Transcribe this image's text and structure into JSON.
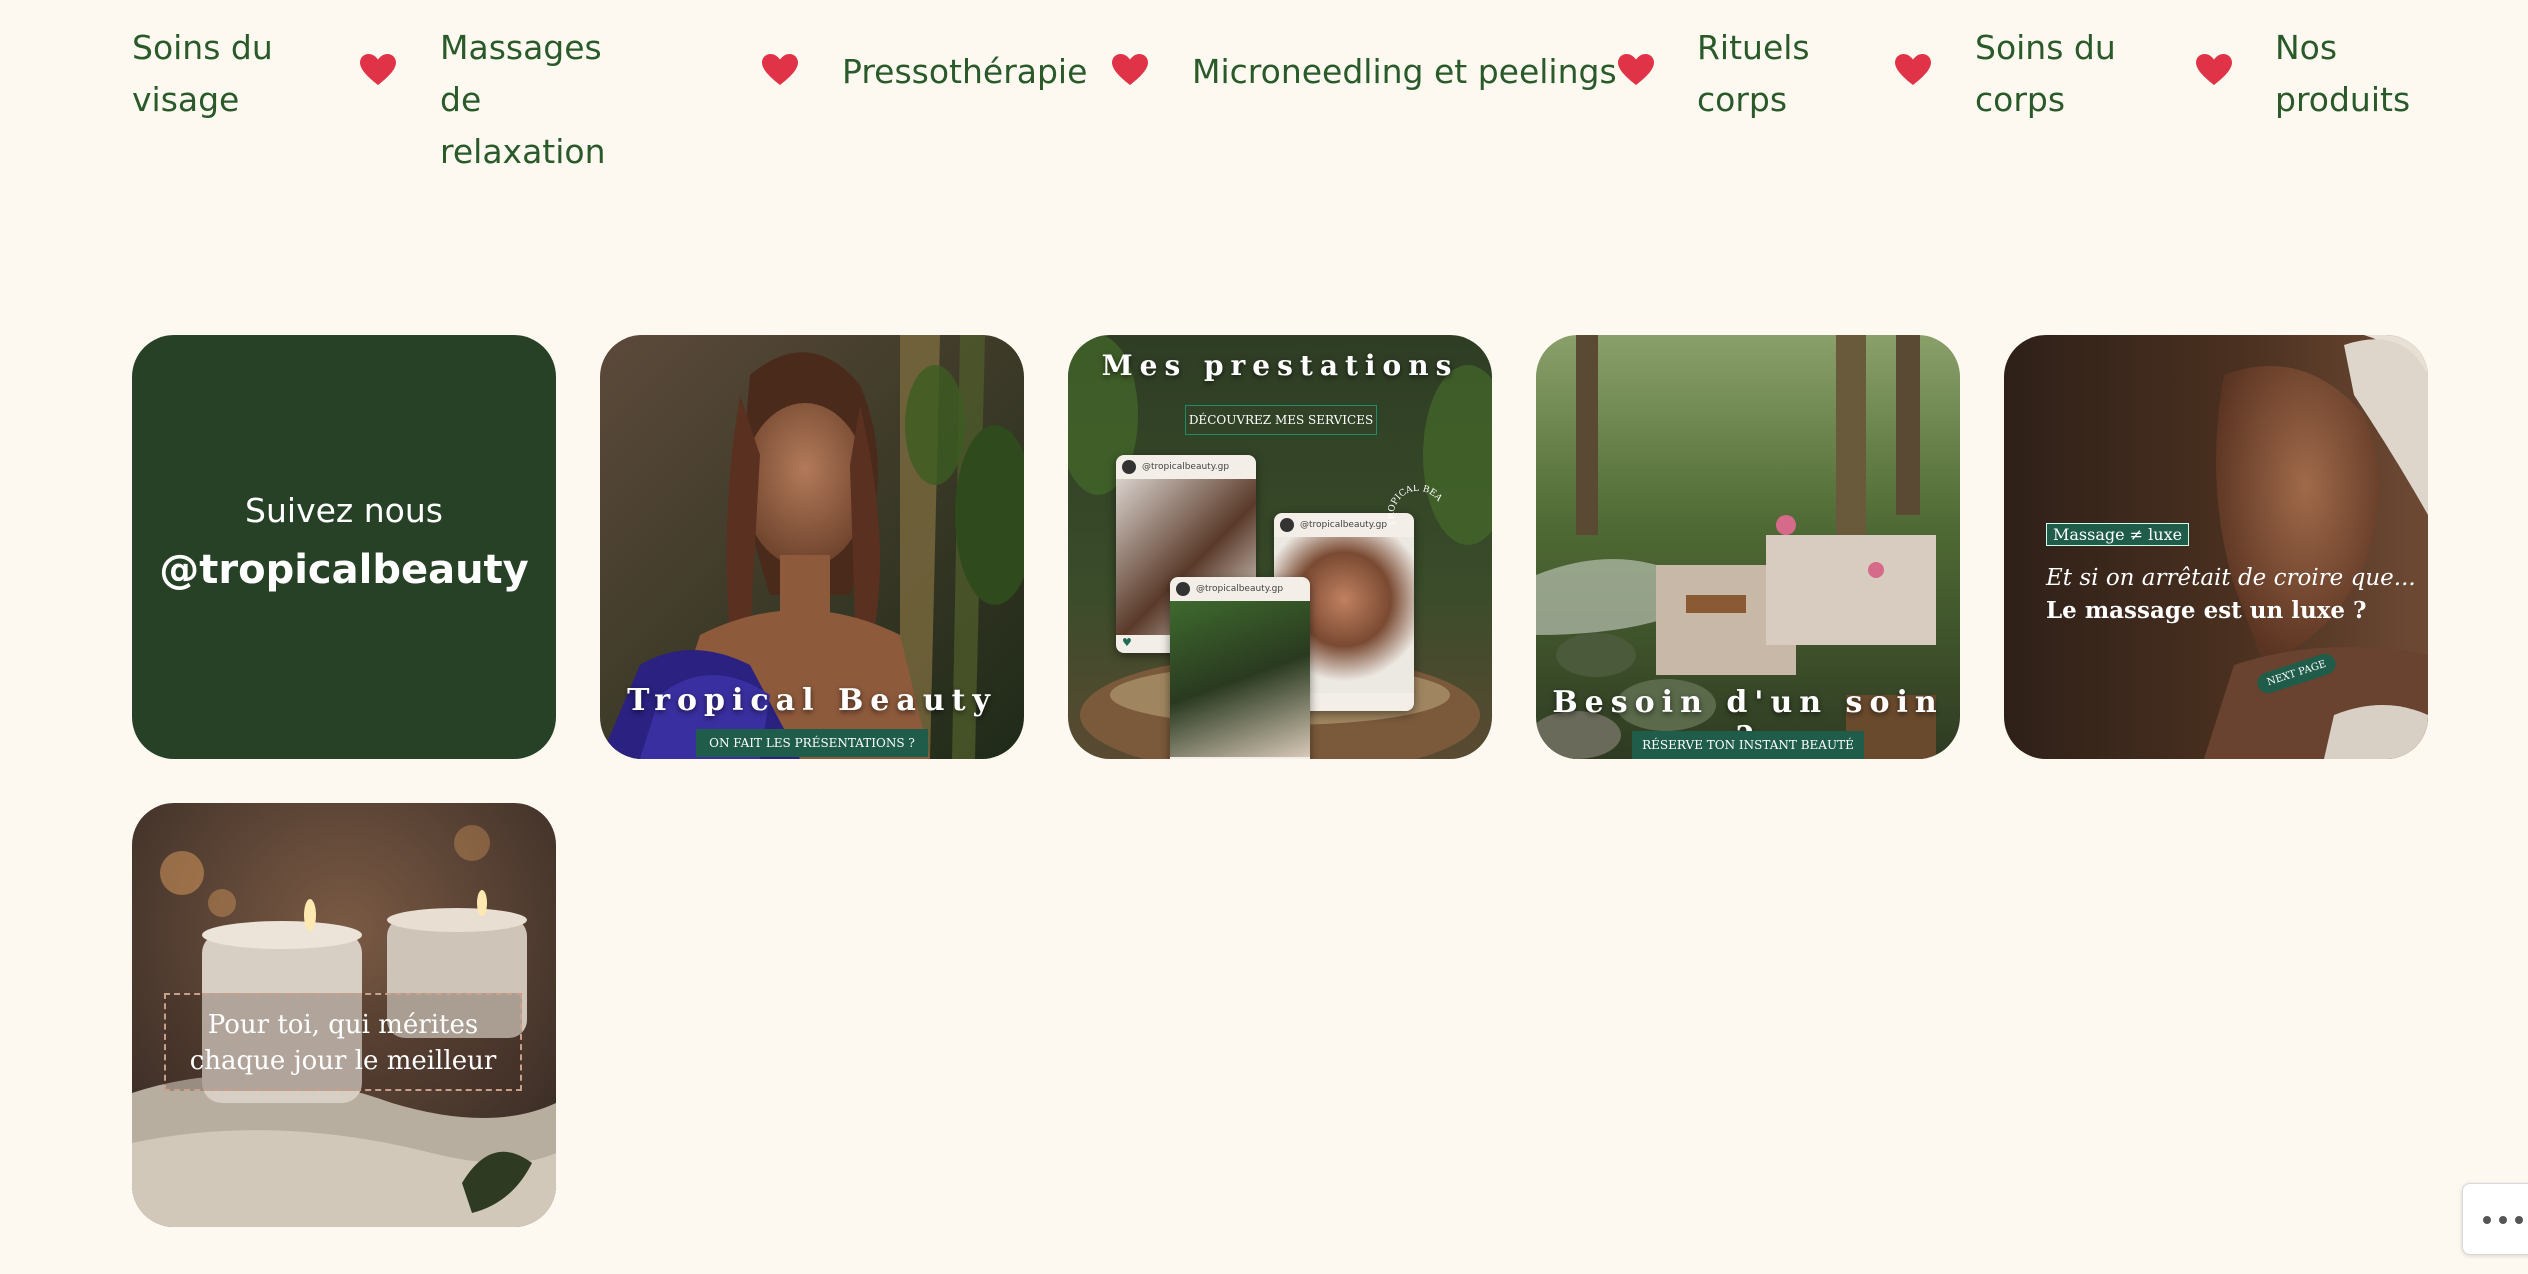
{
  "nav": {
    "items": [
      {
        "label": "Soins du visage"
      },
      {
        "label": "Massages de relaxation"
      },
      {
        "label": "Pressothérapie"
      },
      {
        "label": "Microneedling et peelings"
      },
      {
        "label": "Rituels corps"
      },
      {
        "label": "Soins du corps"
      },
      {
        "label": "Nos produits"
      }
    ],
    "separator_icon": "heart-icon",
    "separator_color": "#e03347",
    "text_color": "#2b5a2a"
  },
  "instagram": {
    "follow_line1": "Suivez nous",
    "follow_handle": "@tropicalbeauty",
    "posts": [
      {
        "title": "Tropical Beauty",
        "button": "ON FAIT LES PRÉSENTATIONS ?"
      },
      {
        "title": "Mes prestations",
        "button": "DÉCOUVREZ MES SERVICES",
        "post_handle": "@tropicalbeauty.gp",
        "badge": "TROPICAL BEAUTY"
      },
      {
        "title": "Besoin d'un soin ?",
        "button": "RÉSERVE TON INSTANT BEAUTÉ"
      },
      {
        "tag": "Massage ≠ luxe",
        "line1": "Et si on arrêtait de croire que...",
        "line2": "Le massage est un luxe ?",
        "button": "NEXT PAGE"
      },
      {
        "text": "Pour toi, qui mérites chaque jour le meilleur"
      }
    ]
  },
  "colors": {
    "page_bg": "#fdf9f1",
    "follow_bg": "#274127",
    "button_green": "#1f5d4a"
  },
  "more_button_icon": "ellipsis-icon"
}
